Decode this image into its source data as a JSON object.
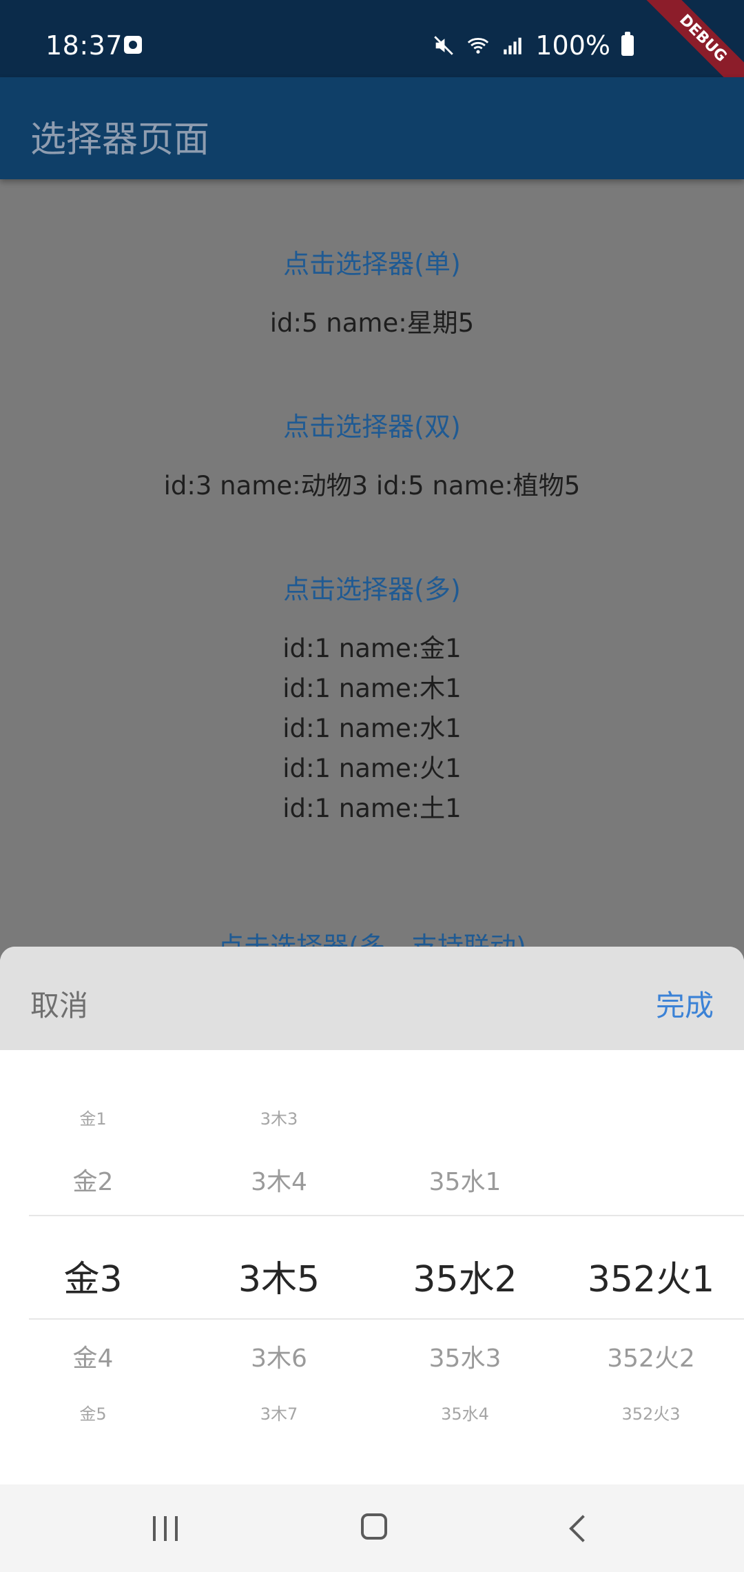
{
  "status": {
    "time": "18:37",
    "battery": "100%",
    "debug_banner": "DEBUG"
  },
  "appbar": {
    "title": "选择器页面"
  },
  "content": {
    "single_link": "点击选择器(单)",
    "single_result": "id:5 name:星期5",
    "double_link": "点击选择器(双)",
    "double_result": "id:3 name:动物3  id:5 name:植物5",
    "multi_link": "点击选择器(多)",
    "multi_results": [
      "id:1 name:金1",
      "id:1 name:木1",
      "id:1 name:水1",
      "id:1 name:火1",
      "id:1 name:土1"
    ],
    "linked_link": "点击选择器(多，支持联动)"
  },
  "sheet": {
    "cancel": "取消",
    "done": "完成",
    "columns": [
      {
        "items": [
          "金1",
          "金2",
          "金3",
          "金4",
          "金5"
        ]
      },
      {
        "items": [
          "3木3",
          "3木4",
          "3木5",
          "3木6",
          "3木7"
        ]
      },
      {
        "items": [
          "",
          "35水1",
          "35水2",
          "35水3",
          "35水4"
        ]
      },
      {
        "items": [
          "",
          "",
          "352火1",
          "352火2",
          "352火3"
        ]
      }
    ]
  },
  "colors": {
    "status_bar": "#0b2b4a",
    "app_bar": "#0f3f68",
    "link": "#1f5a93",
    "done": "#3b82d6"
  }
}
